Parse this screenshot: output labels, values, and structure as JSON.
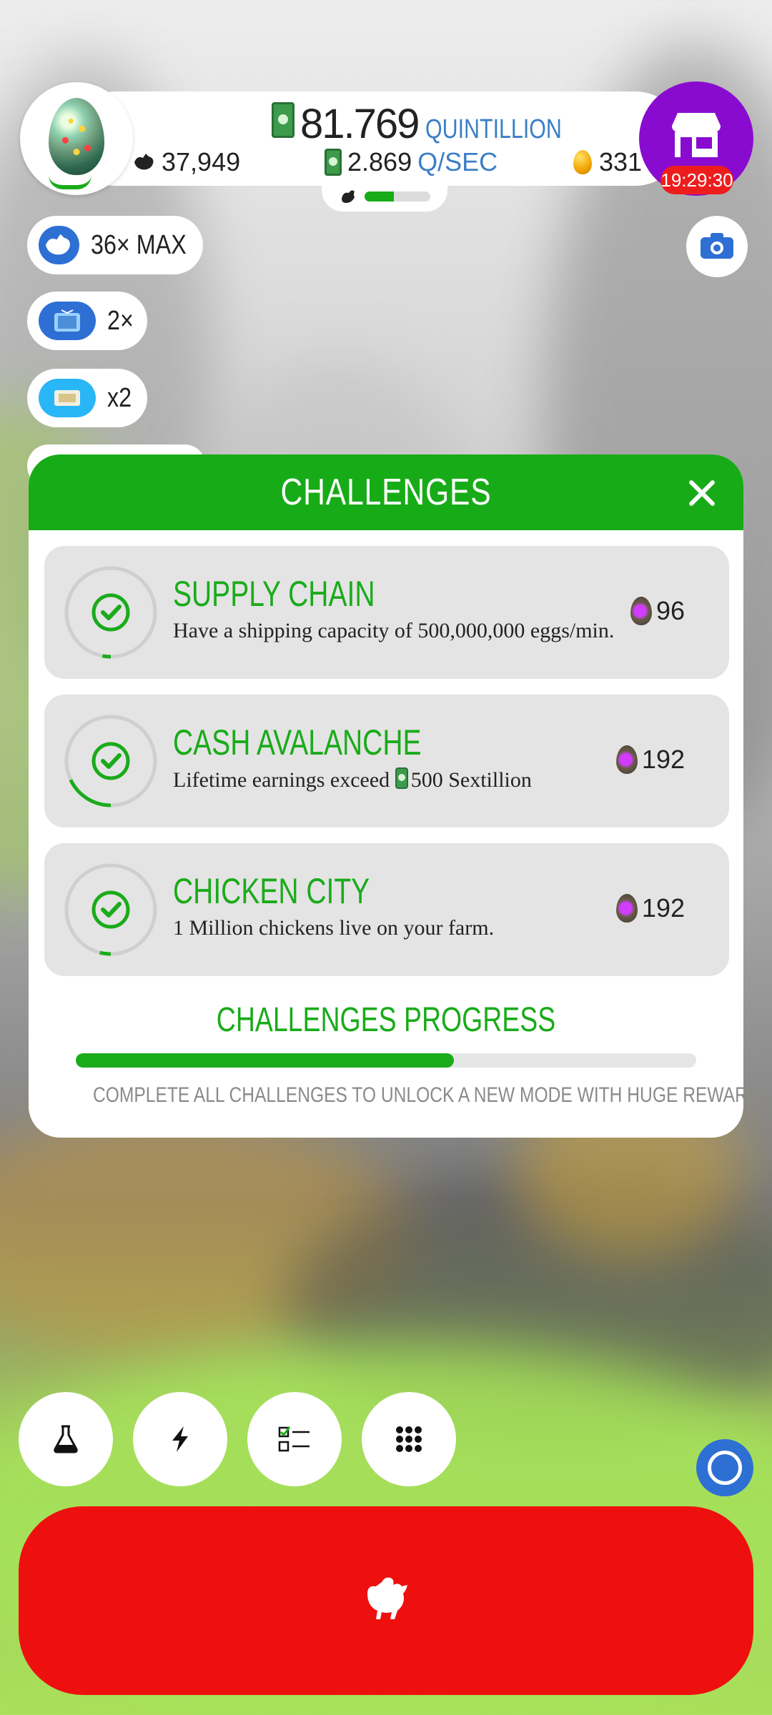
{
  "header": {
    "cash_value": "81.769",
    "cash_unit": "QUINTILLION",
    "chickens": "37,949",
    "rate_value": "2.869",
    "rate_unit": "Q/SEC",
    "golden_eggs": "331",
    "habitat_progress": 0.45
  },
  "shop": {
    "timer": "19:29:30",
    "color": "#8a0bd0"
  },
  "boosts": [
    {
      "icon": "chicken-icon",
      "label": "36× MAX"
    },
    {
      "icon": "tv-icon",
      "label": "2×"
    },
    {
      "icon": "ticket-icon",
      "label": "x2"
    }
  ],
  "challenges_modal": {
    "title": "CHALLENGES",
    "items": [
      {
        "title": "SUPPLY CHAIN",
        "description": "Have a shipping capacity of 500,000,000 eggs/min.",
        "reward": "96",
        "progress": 0.03
      },
      {
        "title": "CASH AVALANCHE",
        "description_prefix": "Lifetime earnings exceed",
        "description_suffix": "500 Sextillion",
        "reward": "192",
        "progress": 0.18
      },
      {
        "title": "CHICKEN CITY",
        "description": "1 Million chickens live on your farm.",
        "reward": "192",
        "progress": 0.04
      }
    ],
    "progress_title": "CHALLENGES PROGRESS",
    "progress": 0.61,
    "progress_note": "COMPLETE ALL CHALLENGES TO UNLOCK A NEW MODE WITH HUGE REWARDS!"
  },
  "colors": {
    "accent_green": "#1aab1a",
    "hatch_red": "#ee0f0f",
    "rate_blue": "#3a7ec7"
  }
}
